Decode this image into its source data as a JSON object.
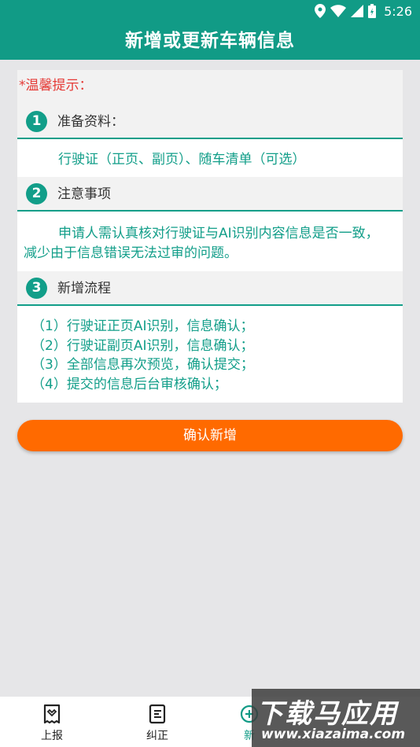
{
  "status_bar": {
    "time": "5:26"
  },
  "header": {
    "title": "新增或更新车辆信息"
  },
  "tip": {
    "label": "*温馨提示："
  },
  "sections": [
    {
      "number": "1",
      "title": "准备资料：",
      "lines": [
        "行驶证（正页、副页）、随车清单（可选）"
      ]
    },
    {
      "number": "2",
      "title": "注意事项",
      "lines": [
        "申请人需认真核对行驶证与AI识别内容信息是否一致，",
        "减少由于信息错误无法过审的问题。"
      ]
    },
    {
      "number": "3",
      "title": "新增流程",
      "lines": [
        "（1）行驶证正页AI识别，信息确认；",
        "（2）行驶证副页AI识别，信息确认；",
        "（3）全部信息再次预览，确认提交；",
        "（4）提交的信息后台审核确认；"
      ]
    }
  ],
  "confirm_button": {
    "label": "确认新增"
  },
  "bottom_nav": {
    "items": [
      {
        "label": "上报",
        "icon": "report-icon"
      },
      {
        "label": "纠正",
        "icon": "correct-icon"
      },
      {
        "label": "新",
        "icon": "add-icon"
      }
    ]
  },
  "watermark": {
    "main": "下载马应用",
    "sub": "www.xiazaima.com"
  },
  "colors": {
    "primary": "#119b86",
    "accent": "#ff6a00",
    "tip": "#e53935"
  }
}
